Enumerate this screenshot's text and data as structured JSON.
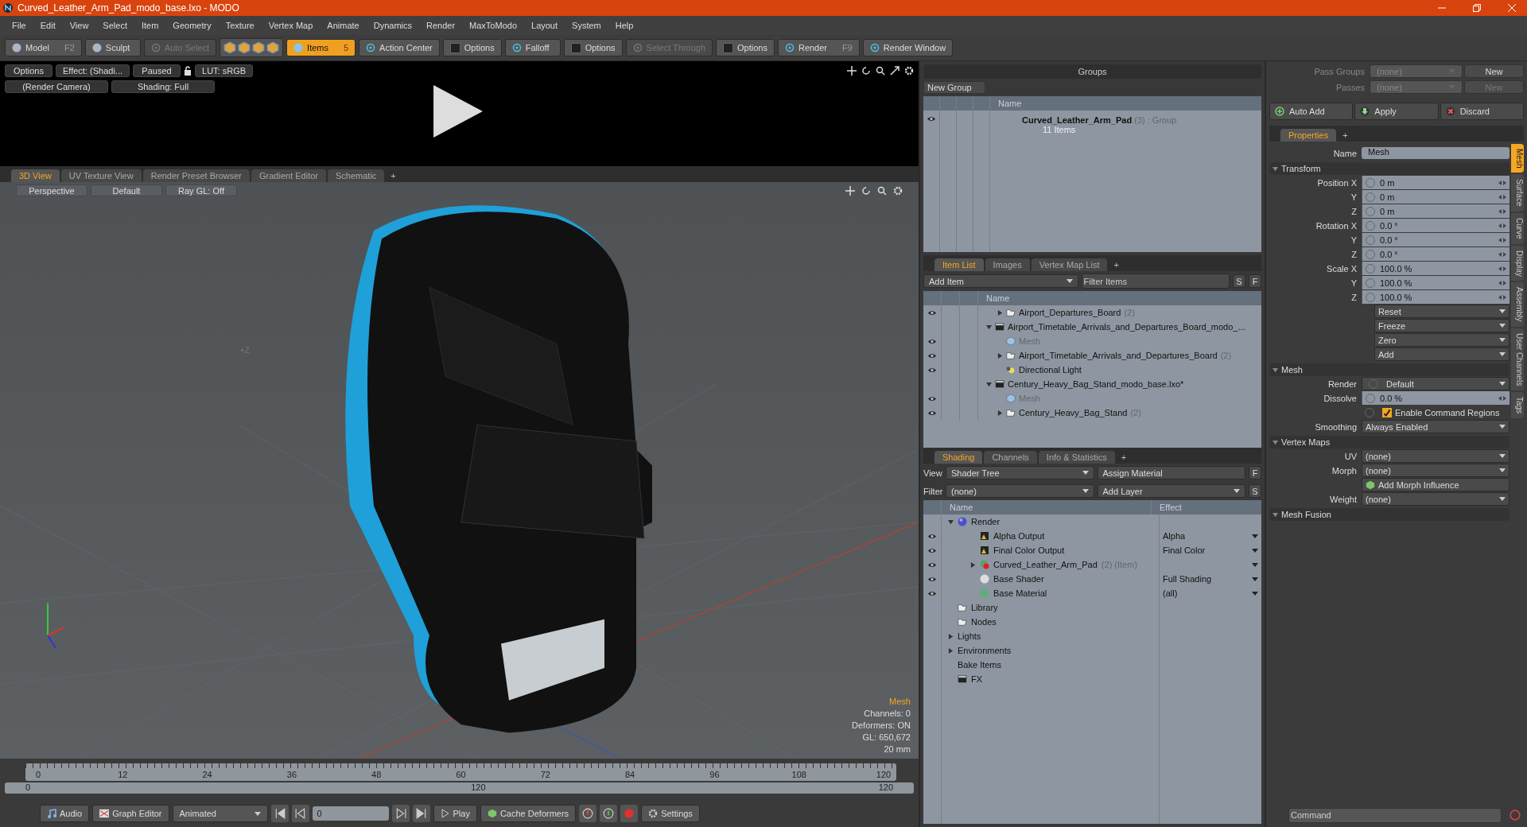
{
  "window": {
    "title": "Curved_Leather_Arm_Pad_modo_base.lxo - MODO"
  },
  "menu": [
    "File",
    "Edit",
    "View",
    "Select",
    "Item",
    "Geometry",
    "Texture",
    "Vertex Map",
    "Animate",
    "Dynamics",
    "Render",
    "MaxToModo",
    "Layout",
    "System",
    "Help"
  ],
  "toolbar": [
    {
      "kind": "mode",
      "label": "Model",
      "shortcut": "F2",
      "selected": false,
      "disabled": false
    },
    {
      "kind": "mode",
      "label": "Sculpt",
      "selected": false,
      "disabled": false
    },
    {
      "kind": "button",
      "label": "Auto Select",
      "selected": false,
      "disabled": true
    },
    {
      "kind": "icons"
    },
    {
      "kind": "mode",
      "label": "Items",
      "shortcut": "5",
      "selected": true,
      "disabled": false
    },
    {
      "kind": "button",
      "label": "Action Center",
      "selected": false,
      "disabled": false
    },
    {
      "kind": "check",
      "label": "Options",
      "selected": false,
      "disabled": false
    },
    {
      "kind": "button",
      "label": "Falloff",
      "selected": false,
      "disabled": false
    },
    {
      "kind": "check",
      "label": "Options",
      "selected": false,
      "disabled": false
    },
    {
      "kind": "button",
      "label": "Select Through",
      "selected": false,
      "disabled": true
    },
    {
      "kind": "check",
      "label": "Options",
      "selected": false,
      "disabled": false
    },
    {
      "kind": "button",
      "label": "Render",
      "shortcut": "F9",
      "selected": false,
      "disabled": false
    },
    {
      "kind": "button",
      "label": "Render Window",
      "selected": false,
      "disabled": false
    }
  ],
  "preview": {
    "row1": [
      "Options",
      "Effect: (Shadi...",
      "Paused"
    ],
    "lut": "LUT: sRGB",
    "row2": [
      "(Render Camera)",
      "Shading: Full"
    ]
  },
  "viewport": {
    "tabs": [
      {
        "label": "3D View",
        "selected": true
      },
      {
        "label": "UV Texture View",
        "selected": false
      },
      {
        "label": "Render Preset Browser",
        "selected": false
      },
      {
        "label": "Gradient Editor",
        "selected": false
      },
      {
        "label": "Schematic",
        "selected": false
      }
    ],
    "add_tab": "+",
    "buttons": [
      "Perspective",
      "Default",
      "Ray GL: Off"
    ],
    "axis_label": "+Z",
    "info": {
      "item": "Mesh",
      "lines": [
        "Channels: 0",
        "Deformers: ON",
        "GL: 650,672",
        "20 mm"
      ]
    }
  },
  "timeline": {
    "ticks": [
      "0",
      "12",
      "24",
      "36",
      "48",
      "60",
      "72",
      "84",
      "96",
      "108",
      "120"
    ],
    "range": [
      "0",
      "120",
      "120"
    ]
  },
  "bottom_bar": {
    "audio": "Audio",
    "graph": "Graph Editor",
    "mode": "Animated",
    "frame": "0",
    "play": "Play",
    "cache": "Cache Deformers",
    "settings": "Settings"
  },
  "groups": {
    "title": "Groups",
    "new_group": "New Group",
    "column": "Name",
    "rows": [
      {
        "name": "Curved_Leather_Arm_Pad",
        "count": "(3)",
        "type": ": Group",
        "sub": "11 Items",
        "visible": true
      }
    ]
  },
  "item_list": {
    "tabs": [
      {
        "label": "Item List",
        "selected": true
      },
      {
        "label": "Images",
        "selected": false
      },
      {
        "label": "Vertex Map List",
        "selected": false
      }
    ],
    "add_tab": "+",
    "add_item": "Add Item",
    "filter": {
      "placeholder": "Filter Items"
    },
    "s": "S",
    "f": "F",
    "column": "Name",
    "items": [
      {
        "kind": "folder",
        "name": "Airport_Departures_Board",
        "count": "(2)",
        "visible": true,
        "expanded": false
      },
      {
        "kind": "scene",
        "name": "Airport_Timetable_Arrivals_and_Departures_Board_modo_...",
        "visible": false,
        "expanded": true,
        "children": [
          {
            "kind": "mesh",
            "name": "Mesh",
            "visible": true
          },
          {
            "kind": "folder",
            "name": "Airport_Timetable_Arrivals_and_Departures_Board",
            "count": "(2)",
            "visible": true,
            "expanded": false
          },
          {
            "kind": "light",
            "name": "Directional Light",
            "visible": true
          }
        ]
      },
      {
        "kind": "scene",
        "name": "Century_Heavy_Bag_Stand_modo_base.lxo*",
        "visible": false,
        "expanded": true,
        "children": [
          {
            "kind": "mesh",
            "name": "Mesh",
            "visible": true
          },
          {
            "kind": "folder",
            "name": "Century_Heavy_Bag_Stand",
            "count": "(2)",
            "visible": true,
            "expanded": false
          }
        ]
      }
    ]
  },
  "shading": {
    "tabs": [
      {
        "label": "Shading",
        "selected": true
      },
      {
        "label": "Channels",
        "selected": false
      },
      {
        "label": "Info & Statistics",
        "selected": false
      }
    ],
    "add_tab": "+",
    "view_label": "View",
    "view": "Shader Tree",
    "assign": "Assign Material",
    "f": "F",
    "filter_label": "Filter",
    "filter": "(none)",
    "add_layer": "Add Layer",
    "s": "S",
    "columns": [
      "Name",
      "Effect"
    ],
    "tree": [
      {
        "kind": "render",
        "name": "Render",
        "visible": false,
        "expanded": true,
        "children": [
          {
            "kind": "output",
            "name": "Alpha Output",
            "effect": "Alpha",
            "visible": true
          },
          {
            "kind": "output",
            "name": "Final Color Output",
            "effect": "Final Color",
            "visible": true
          },
          {
            "kind": "group",
            "name": "Curved_Leather_Arm_Pad",
            "suffix": "(2) (Item)",
            "visible": true,
            "expanded": false
          },
          {
            "kind": "shader",
            "name": "Base Shader",
            "effect": "Full Shading",
            "visible": true
          },
          {
            "kind": "material",
            "name": "Base Material",
            "effect": "(all)",
            "visible": true
          }
        ]
      },
      {
        "kind": "folder",
        "name": "Library",
        "visible": false
      },
      {
        "kind": "folder",
        "name": "Nodes",
        "visible": false
      },
      {
        "kind": "plain",
        "name": "Lights",
        "visible": false,
        "expanded": false
      },
      {
        "kind": "plain",
        "name": "Environments",
        "visible": false,
        "expanded": false
      },
      {
        "kind": "plain",
        "name": "Bake Items",
        "visible": false
      },
      {
        "kind": "fx",
        "name": "FX",
        "visible": false
      }
    ]
  },
  "passes": [
    {
      "label": "Pass Groups",
      "value": "(none)",
      "button": "New",
      "disabled": false
    },
    {
      "label": "Passes",
      "value": "(none)",
      "button": "New",
      "disabled": true
    }
  ],
  "actions": [
    "Auto Add",
    "Apply",
    "Discard"
  ],
  "properties": {
    "tab": "Properties",
    "add_tab": "+",
    "name_label": "Name",
    "name": "Mesh",
    "side_tabs": [
      {
        "label": "Mesh",
        "selected": true
      },
      {
        "label": "Surface",
        "selected": false
      },
      {
        "label": "Curve",
        "selected": false
      },
      {
        "label": "Display",
        "selected": false
      },
      {
        "label": "Assembly",
        "selected": false
      },
      {
        "label": "User Channels",
        "selected": false
      },
      {
        "label": "Tags",
        "selected": false
      }
    ],
    "sections": [
      {
        "title": "Transform",
        "rows": [
          {
            "kind": "value",
            "label": "Position X",
            "value": "0 m"
          },
          {
            "kind": "value",
            "label": "Y",
            "value": "0 m"
          },
          {
            "kind": "value",
            "label": "Z",
            "value": "0 m"
          },
          {
            "kind": "value",
            "label": "Rotation X",
            "value": "0.0 °"
          },
          {
            "kind": "value",
            "label": "Y",
            "value": "0.0 °"
          },
          {
            "kind": "value",
            "label": "Z",
            "value": "0.0 °"
          },
          {
            "kind": "value",
            "label": "Scale X",
            "value": "100.0 %"
          },
          {
            "kind": "value",
            "label": "Y",
            "value": "100.0 %"
          },
          {
            "kind": "value",
            "label": "Z",
            "value": "100.0 %"
          },
          {
            "kind": "menu",
            "value": "Reset"
          },
          {
            "kind": "menu",
            "value": "Freeze"
          },
          {
            "kind": "menu",
            "value": "Zero"
          },
          {
            "kind": "menu",
            "value": "Add"
          }
        ]
      },
      {
        "title": "Mesh",
        "rows": [
          {
            "kind": "dropdown",
            "label": "Render",
            "value": "Default",
            "toggle": true
          },
          {
            "kind": "value",
            "label": "Dissolve",
            "value": "0.0 %"
          },
          {
            "kind": "check",
            "label": "Enable Command Regions",
            "checked": true
          },
          {
            "kind": "dropdown",
            "label": "Smoothing",
            "value": "Always Enabled"
          }
        ]
      },
      {
        "title": "Vertex Maps",
        "rows": [
          {
            "kind": "dropdown",
            "label": "UV",
            "value": "(none)"
          },
          {
            "kind": "dropdown",
            "label": "Morph",
            "value": "(none)"
          },
          {
            "kind": "button",
            "value": "Add Morph Influence"
          },
          {
            "kind": "dropdown",
            "label": "Weight",
            "value": "(none)"
          }
        ]
      },
      {
        "title": "Mesh Fusion"
      }
    ]
  },
  "command": {
    "placeholder": "Command"
  }
}
